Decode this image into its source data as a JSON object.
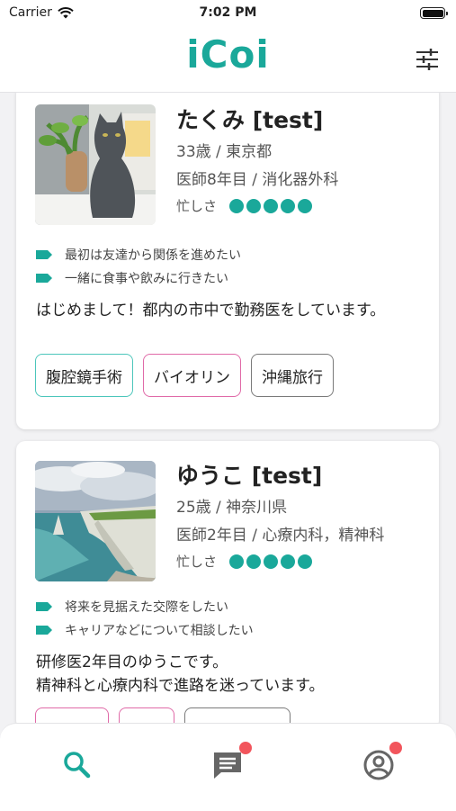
{
  "status_bar": {
    "carrier": "Carrier",
    "time": "7:02 PM"
  },
  "header": {
    "logo": "iCoi"
  },
  "colors": {
    "accent": "#1aa89a",
    "badge": "#f2555c",
    "chip_teal": "#4cc6bb",
    "chip_pink": "#e06aa8",
    "chip_gray": "#7a7a7a"
  },
  "profiles": [
    {
      "name": "たくみ [test]",
      "age_location": "33歳 / 東京都",
      "job": "医師8年目 / 消化器外科",
      "busy_label": "忙しさ",
      "busy_level": 5,
      "purposes": [
        "最初は友達から関係を進めたい",
        "一緒に食事や飲みに行きたい"
      ],
      "intro": "はじめまして！都内の市中で勤務医をしています。",
      "tags": [
        "腹腔鏡手術",
        "バイオリン",
        "沖縄旅行"
      ]
    },
    {
      "name": "ゆうこ [test]",
      "age_location": "25歳 / 神奈川県",
      "job": "医師2年目 / 心療内科，精神科",
      "busy_label": "忙しさ",
      "busy_level": 5,
      "purposes": [
        "将来を見据えた交際をしたい",
        "キャリアなどについて相談したい"
      ],
      "intro_lines": [
        "研修医2年目のゆうこです。",
        "精神科と心療内科で進路を迷っています。"
      ]
    }
  ],
  "tab_bar": {
    "icons": [
      "search-icon",
      "messages-icon",
      "profile-icon"
    ]
  }
}
